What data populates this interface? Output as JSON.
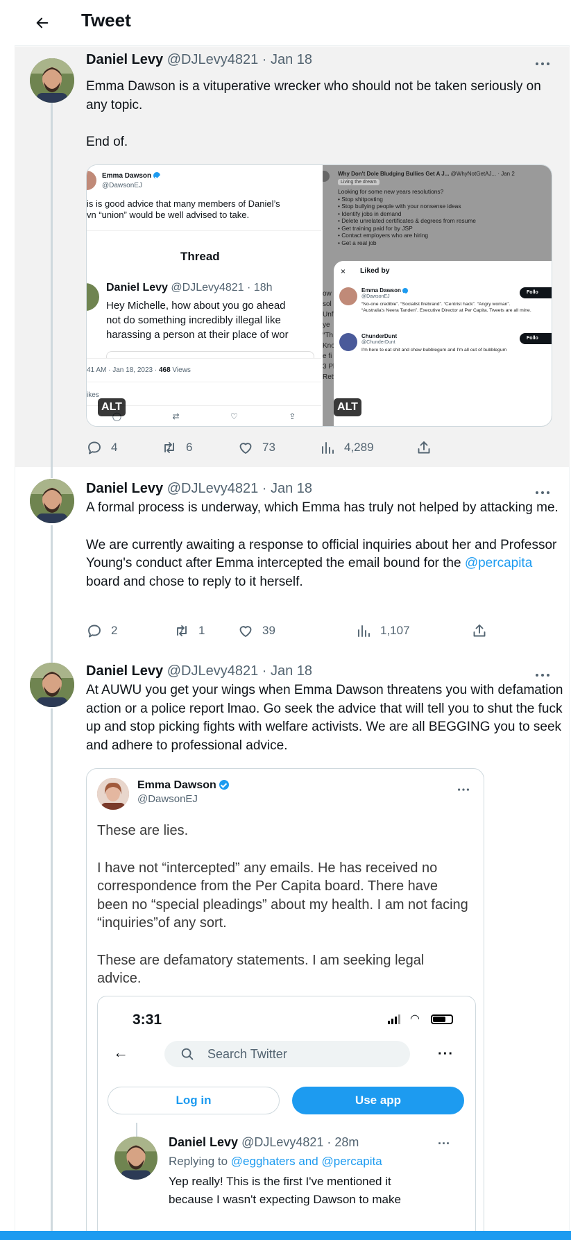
{
  "header": {
    "title": "Tweet"
  },
  "author": {
    "name": "Daniel Levy",
    "handle": "@DJLevy4821"
  },
  "tweets": [
    {
      "date": "· Jan 18",
      "text": [
        "Emma Dawson is a vituperative wrecker who should not be taken seriously on any topic.",
        "End of."
      ],
      "stats": {
        "replies": "4",
        "retweets": "6",
        "likes": "73",
        "views": "4,289"
      },
      "media": {
        "left": {
          "account_name": "Emma Dawson",
          "account_handle": "@DawsonEJ",
          "snippet_line1": "is is good advice that many members of Daniel’s",
          "snippet_line2": "vn “union” would be well advised to take.",
          "thread_label": "Thread",
          "reply_name": "Daniel Levy",
          "reply_handle": "@DJLevy4821 · 18h",
          "reply_line1": "Hey Michelle, how about you go ahead",
          "reply_line2": "not do something incredibly illegal like",
          "reply_line3": "harassing a person at their place of wor",
          "meta": "41 AM · Jan 18, 2023 · ",
          "views_count": "468",
          "views_label": "Views",
          "likes_label": "ikes",
          "alt": "ALT"
        },
        "right": {
          "top_title": "Why Don't Dole Bludging Bullies Get A J...",
          "top_handle": "@WhyNotGetAJ... · Jan 2",
          "badge": "Living the dream",
          "lines": [
            "Looking for some new years resolutions?",
            "• Stop shitposting",
            "• Stop bullying people with your nonsense ideas",
            "• Identify jobs in demand",
            "• Delete unrelated certificates & degrees from resume",
            "• Get training paid for by JSP",
            "• Contact employers who are hiring",
            "• Get a real job"
          ],
          "side_fragments": [
            "ow",
            "sol",
            "Unf",
            "ye",
            "“Th",
            "Kno",
            "e fi",
            "3 Pl",
            "Retw"
          ],
          "liked_by_title": "Liked by",
          "close": "×",
          "users": [
            {
              "name": "Emma Dawson",
              "handle": "@DawsonEJ",
              "bio": "“No-one credible”. “Socialist firebrand”. “Centrist hack”. “Angry woman”. “Australia's Neera Tanden”. Executive Director at Per Capita. Tweets are all mine.",
              "follow": "Follo"
            },
            {
              "name": "ChunderDunt",
              "handle": "@ChunderDunt",
              "bio": "I'm here to eat shit and chew bubblegum and I'm all out of bubblegum",
              "follow": "Follo"
            }
          ],
          "alt": "ALT"
        }
      }
    },
    {
      "date": "· Jan 18",
      "text": [
        "A formal process is underway, which Emma has truly not helped by attacking me."
      ],
      "text2_before": "We are currently awaiting a response to official inquiries about her and Professor Young's conduct after Emma intercepted the email bound for the ",
      "text2_link": "@percapita",
      "text2_after": " board and chose to reply to it herself.",
      "stats": {
        "replies": "2",
        "retweets": "1",
        "likes": "39",
        "views": "1,107"
      }
    },
    {
      "date": "· Jan 18",
      "text": [
        "At AUWU you get your wings when Emma Dawson threatens you with defamation action or a police report lmao. Go seek the advice that will tell you to shut the fuck up and stop picking fights with welfare activists. We are all BEGGING you to seek and adhere to professional advice."
      ],
      "quote": {
        "name": "Emma Dawson",
        "handle": "@DawsonEJ",
        "p1": "These are lies.",
        "p2": "I have not “intercepted” any emails. He has received no correspondence from the Per Capita board. There have been no “special pleadings” about my health. I am not facing “inquiries”of any sort.",
        "p3": "These are defamatory statements. I am seeking legal advice.",
        "phone": {
          "time": "3:31",
          "search_placeholder": "Search Twitter",
          "login": "Log in",
          "use_app": "Use app",
          "reply_name": "Daniel Levy",
          "reply_handle": "@DJLevy4821 · 28m",
          "replying_label": "Replying to",
          "replying_to": "@egghaters and @percapita",
          "reply_line1": "Yep really! This is the first I've mentioned it",
          "reply_line2": "because I wasn't expecting Dawson to make"
        }
      }
    }
  ],
  "colors": {
    "accent": "#1d9bf0",
    "secondary_text": "#536471",
    "border": "#cfd9de"
  }
}
